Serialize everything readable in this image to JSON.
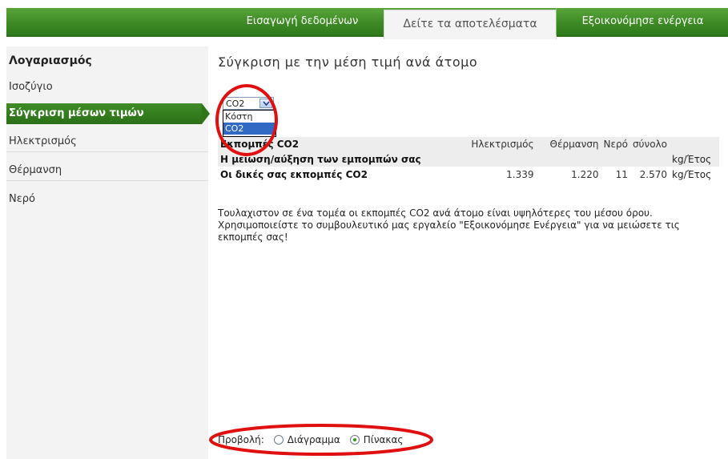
{
  "top_tabs": [
    {
      "label": "Εισαγωγή δεδομένων"
    },
    {
      "label": "Δείτε τα αποτελέσματα",
      "active": true
    },
    {
      "label": "Εξοικονόμησε ενέργεια"
    }
  ],
  "sidebar": {
    "heading": "Λογαριασμός",
    "items": [
      {
        "label": "Ισοζύγιο"
      },
      {
        "label": "Σύγκριση μέσων τιμών",
        "active": true
      },
      {
        "label": "Ηλεκτρισμός"
      },
      {
        "label": "Θέρμανση"
      },
      {
        "label": "Νερό"
      }
    ]
  },
  "main": {
    "title": "Σύγκριση με την μέση τιμή ανά άτομο",
    "select": {
      "value": "CO2",
      "options": [
        "Κόστη",
        "CO2"
      ]
    },
    "table": {
      "header": [
        "Εκπομπές CO2",
        "Ηλεκτρισμός",
        "Θέρμανση",
        "Νερό",
        "σύνολο"
      ],
      "rows": [
        {
          "label": "Η μείωση/αύξηση των εμπομπών σας",
          "values": [
            "",
            "",
            "",
            ""
          ],
          "unit": "kg/Έτος"
        },
        {
          "label": "Οι δικές σας εκπομπές CO2",
          "values": [
            "1.339",
            "1.220",
            "11",
            "2.570"
          ],
          "unit": "kg/Έτος"
        }
      ]
    },
    "note": "Τουλαχιστον σε ένα τομέα οι εκπομπές CO2 ανά άτομο είναι υψηλότερες του μέσου όρου. Χρησιμοποιείστε το συμβουλευτικό μας εργαλείο \"Εξοικονόμησε Ενέργεια\" για να μειώσετε τις εκπομπές σας!",
    "view": {
      "label": "Προβολή:",
      "options": [
        {
          "label": "Διάγραμμα",
          "checked": false
        },
        {
          "label": "Πίνακας",
          "checked": true
        }
      ]
    }
  },
  "colors": {
    "accent_green": "#3d8a25",
    "highlight_red": "#e01010",
    "selection_blue": "#316ac5"
  }
}
